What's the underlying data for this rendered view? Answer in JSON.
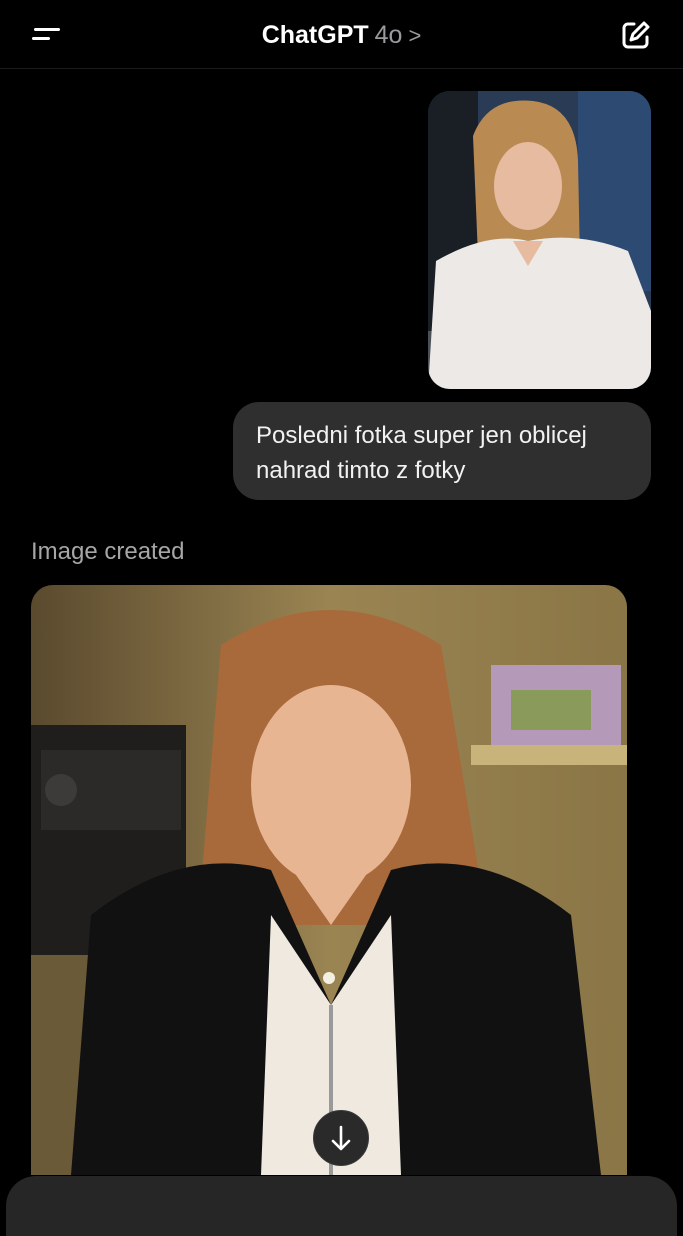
{
  "header": {
    "title": "ChatGPT",
    "model": "4o",
    "chevron": ">",
    "icons": {
      "menu": "menu-icon",
      "compose": "compose-icon"
    }
  },
  "conversation": {
    "user_message": {
      "text_line_1": "Posledni fotka super jen oblicej",
      "text_line_2": "nahrad timto z fotky"
    },
    "assistant": {
      "status": "Image created"
    }
  },
  "controls": {
    "scroll_down_icon": "arrow-down-icon"
  },
  "colors": {
    "background": "#000000",
    "bubble": "#2f2f2f",
    "muted_text": "#a6a6a6"
  }
}
